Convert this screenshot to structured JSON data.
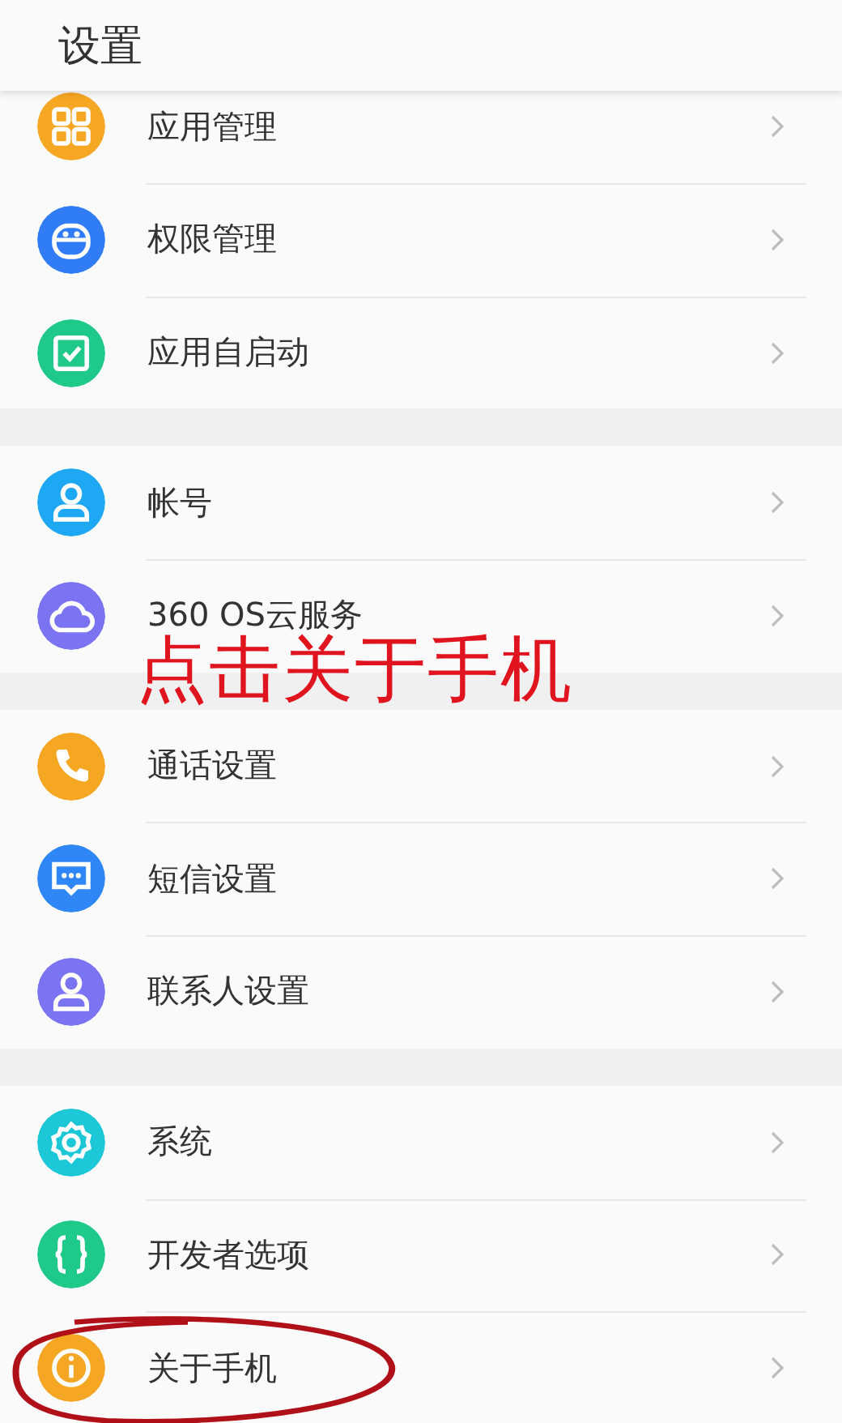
{
  "header": {
    "title": "设置"
  },
  "groups": [
    {
      "items": [
        {
          "label": "应用管理",
          "kind": "grid",
          "color": "#f5a623",
          "highlighted": false
        },
        {
          "label": "权限管理",
          "kind": "robot",
          "color": "#2f7cf6",
          "highlighted": false
        },
        {
          "label": "应用自启动",
          "kind": "checkbox",
          "color": "#1ec98a",
          "highlighted": false
        }
      ]
    },
    {
      "items": [
        {
          "label": "帐号",
          "kind": "person",
          "color": "#1ea7f2",
          "highlighted": false
        },
        {
          "label": "360 OS云服务",
          "kind": "cloud",
          "color": "#7b74f2",
          "highlighted": false
        }
      ]
    },
    {
      "items": [
        {
          "label": "通话设置",
          "kind": "phone",
          "color": "#f5a623",
          "highlighted": false
        },
        {
          "label": "短信设置",
          "kind": "message",
          "color": "#2f86f6",
          "highlighted": false
        },
        {
          "label": "联系人设置",
          "kind": "person",
          "color": "#7b74f2",
          "highlighted": false
        }
      ]
    },
    {
      "items": [
        {
          "label": "系统",
          "kind": "gear",
          "color": "#1cc7d8",
          "highlighted": false
        },
        {
          "label": "开发者选项",
          "kind": "braces",
          "color": "#1ec98a",
          "highlighted": false
        },
        {
          "label": "关于手机",
          "kind": "info",
          "color": "#f5a623",
          "highlighted": true
        }
      ]
    }
  ],
  "annotation": {
    "text": "点击关于手机"
  }
}
